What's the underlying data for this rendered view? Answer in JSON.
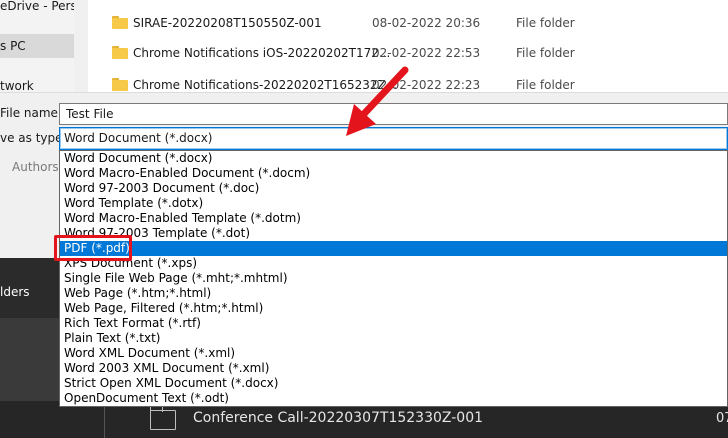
{
  "nav": {
    "items": [
      {
        "label": "eDrive - Perso",
        "selected": false
      },
      {
        "label": "s PC",
        "selected": true
      },
      {
        "label": "twork",
        "selected": false
      }
    ]
  },
  "files": [
    {
      "name": "SIRAE-20220208T150550Z-001",
      "date": "08-02-2022 20:36",
      "type": "File folder"
    },
    {
      "name": "Chrome Notifications iOS-20220202T172...",
      "date": "02-02-2022 22:53",
      "type": "File folder"
    },
    {
      "name": "Chrome Notifications-20220202T165232Z...",
      "date": "02-02-2022 22:23",
      "type": "File folder"
    }
  ],
  "form": {
    "filename_label": "File name:",
    "filename_value": "Test File",
    "savetype_label": "ve as type:",
    "savetype_value": "Word Document (*.docx)",
    "authors_label": "Authors:",
    "folders_label": "lders"
  },
  "dropdown": {
    "options": [
      {
        "label": "Word Document (*.docx)",
        "selected": false
      },
      {
        "label": "Word Macro-Enabled Document (*.docm)",
        "selected": false
      },
      {
        "label": "Word 97-2003 Document (*.doc)",
        "selected": false
      },
      {
        "label": "Word Template (*.dotx)",
        "selected": false
      },
      {
        "label": "Word Macro-Enabled Template (*.dotm)",
        "selected": false
      },
      {
        "label": "Word 97-2003 Template (*.dot)",
        "selected": false
      },
      {
        "label": "PDF (*.pdf)",
        "selected": true
      },
      {
        "label": "XPS Document (*.xps)",
        "selected": false
      },
      {
        "label": "Single File Web Page (*.mht;*.mhtml)",
        "selected": false
      },
      {
        "label": "Web Page (*.htm;*.html)",
        "selected": false
      },
      {
        "label": "Web Page, Filtered (*.htm;*.html)",
        "selected": false
      },
      {
        "label": "Rich Text Format (*.rtf)",
        "selected": false
      },
      {
        "label": "Plain Text (*.txt)",
        "selected": false
      },
      {
        "label": "Word XML Document (*.xml)",
        "selected": false
      },
      {
        "label": "Word 2003 XML Document (*.xml)",
        "selected": false
      },
      {
        "label": "Strict Open XML Document (*.docx)",
        "selected": false
      },
      {
        "label": "OpenDocument Text (*.odt)",
        "selected": false
      }
    ]
  },
  "bottom_bar": {
    "text": "Conference Call-20220307T152330Z-001",
    "right_text": "07"
  },
  "annotation": {
    "arrow_color": "#e3141b",
    "highlight_color": "#e3141b"
  },
  "colors": {
    "selection_blue": "#0078d7",
    "folder_yellow": "#f7c948"
  }
}
